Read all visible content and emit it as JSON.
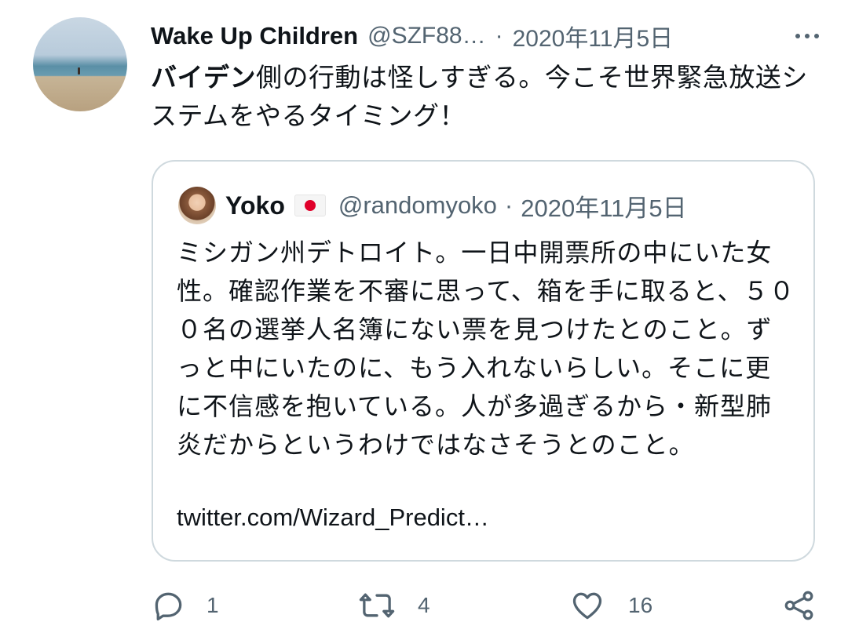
{
  "tweet": {
    "display_name": "Wake Up Children",
    "handle": "@SZF88…",
    "separator": "·",
    "date": "2020年11月5日",
    "text_bold": "バイデン",
    "text_rest": "側の行動は怪しすぎる。今こそ世界緊急放送システムをやるタイミング！"
  },
  "quote": {
    "display_name": "Yoko",
    "flag": "jp-flag-icon",
    "handle": "@randomyoko",
    "separator": "·",
    "date": "2020年11月5日",
    "text": "ミシガン州デトロイト。一日中開票所の中にいた女性。確認作業を不審に思って、箱を手に取ると、５００名の選挙人名簿にない票を見つけたとのこと。ずっと中にいたのに、もう入れないらしい。そこに更に不信感を抱いている。人が多過ぎるから・新型肺炎だからというわけではなさそうとのこと。",
    "link": "twitter.com/Wizard_Predict…"
  },
  "actions": {
    "reply_count": "1",
    "retweet_count": "4",
    "like_count": "16"
  },
  "colors": {
    "text": "#0f1419",
    "muted": "#536471",
    "border": "#cfd9de"
  }
}
